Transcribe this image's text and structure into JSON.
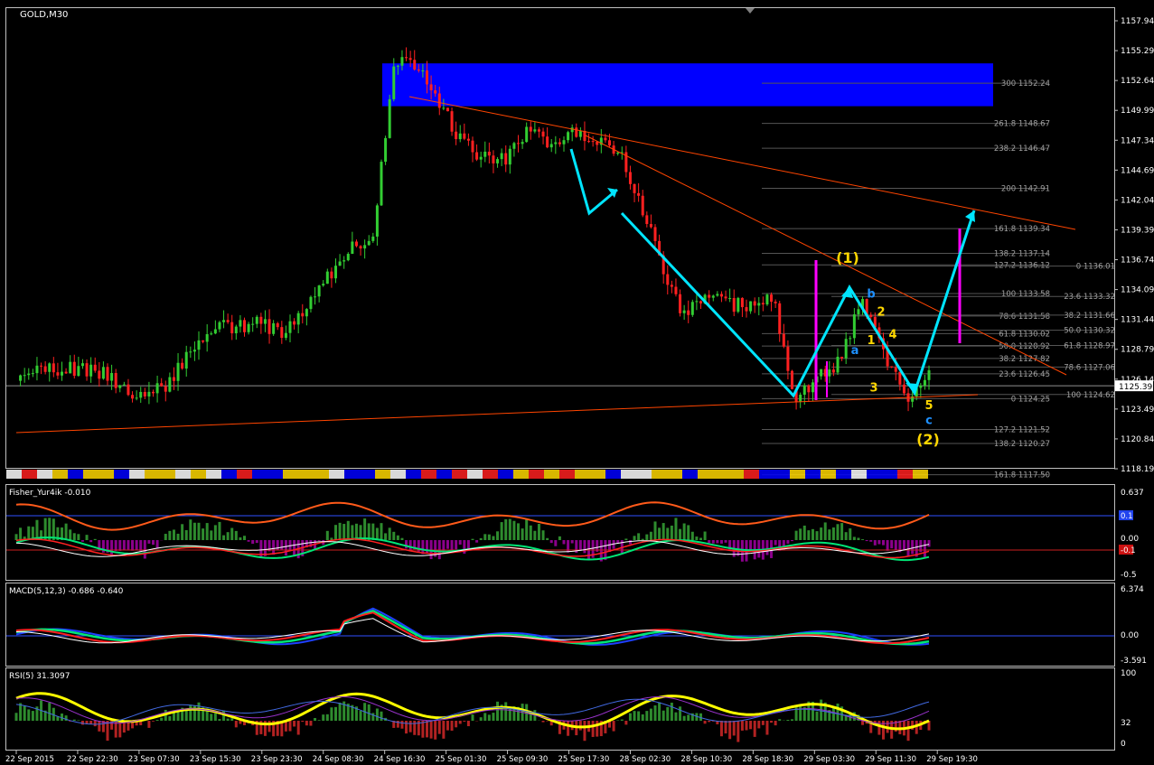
{
  "chart_data": [
    {
      "type": "candlestick",
      "title": "GOLD,M30",
      "y_ticks": [
        "1157.94",
        "1155.29",
        "1152.64",
        "1149.99",
        "1147.34",
        "1144.69",
        "1142.04",
        "1139.39",
        "1136.74",
        "1134.09",
        "1131.44",
        "1128.79",
        "1126.14",
        "1123.49",
        "1120.84",
        "1118.19"
      ],
      "ylim": [
        1118.19,
        1157.94
      ],
      "current_price": "1125.39",
      "anchor_prices": [
        1126.5,
        1127.2,
        1126.8,
        1127.0,
        1126.5,
        1125.0,
        1124.4,
        1126.0,
        1129.0,
        1131.0,
        1130.5,
        1131.0,
        1130.0,
        1132.0,
        1135.0,
        1137.5,
        1138.0,
        1154.5,
        1153.5,
        1150.5,
        1147.0,
        1145.5,
        1145.5,
        1148.0,
        1147.0,
        1148.0,
        1147.5,
        1146.5,
        1142.0,
        1136.0,
        1131.5,
        1134.0,
        1132.5,
        1132.5,
        1133.0,
        1124.5,
        1126.0,
        1127.5,
        1133.5,
        1128.0,
        1124.5,
        1126.5
      ],
      "fib_labels": [
        {
          "price": 1152.24,
          "text": "300 1152.24",
          "col": "left"
        },
        {
          "price": 1148.67,
          "text": "261.8 1148.67",
          "col": "left"
        },
        {
          "price": 1146.47,
          "text": "238.2 1146.47",
          "col": "left"
        },
        {
          "price": 1142.91,
          "text": "200 1142.91",
          "col": "left"
        },
        {
          "price": 1139.34,
          "text": "161.8 1139.34",
          "col": "left"
        },
        {
          "price": 1137.14,
          "text": "138.2 1137.14",
          "col": "left"
        },
        {
          "price": 1136.12,
          "text": "127.2 1136.12",
          "col": "left"
        },
        {
          "price": 1133.58,
          "text": "100 1133.58",
          "col": "left"
        },
        {
          "price": 1131.58,
          "text": "78.6 1131.58",
          "col": "left"
        },
        {
          "price": 1130.02,
          "text": "61.8 1130.02",
          "col": "left"
        },
        {
          "price": 1128.92,
          "text": "50.0 1128.92",
          "col": "left"
        },
        {
          "price": 1127.82,
          "text": "38.2 1127.82",
          "col": "left"
        },
        {
          "price": 1126.45,
          "text": "23.6 1126.45",
          "col": "left"
        },
        {
          "price": 1124.25,
          "text": "0 1124.25",
          "col": "left"
        },
        {
          "price": 1121.52,
          "text": "127.2 1121.52",
          "col": "left"
        },
        {
          "price": 1120.27,
          "text": "138.2 1120.27",
          "col": "left"
        },
        {
          "price": 1117.5,
          "text": "161.8 1117.50",
          "col": "left"
        },
        {
          "price": 1136.01,
          "text": "0 1136.01",
          "col": "right"
        },
        {
          "price": 1133.32,
          "text": "23.6 1133.32",
          "col": "right"
        },
        {
          "price": 1131.66,
          "text": "38.2 1131.66",
          "col": "right"
        },
        {
          "price": 1130.32,
          "text": "50.0 1130.32",
          "col": "right"
        },
        {
          "price": 1128.97,
          "text": "61.8 1128.97",
          "col": "right"
        },
        {
          "price": 1127.06,
          "text": "78.6 1127.06",
          "col": "right"
        },
        {
          "price": 1124.62,
          "text": "100 1124.62",
          "col": "right"
        }
      ],
      "wave_labels": [
        {
          "text": "(1)",
          "color": "#ffd700",
          "price": 1136.3
        },
        {
          "text": "b",
          "color": "#1e90ff",
          "price": 1133.2
        },
        {
          "text": "2",
          "color": "#ffd700",
          "price": 1131.6
        },
        {
          "text": "a",
          "color": "#1e90ff",
          "price": 1128.2
        },
        {
          "text": "1",
          "color": "#ffd700",
          "price": 1129.1
        },
        {
          "text": "4",
          "color": "#ffd700",
          "price": 1129.6
        },
        {
          "text": "3",
          "color": "#ffd700",
          "price": 1124.9
        },
        {
          "text": "5",
          "color": "#ffd700",
          "price": 1123.3
        },
        {
          "text": "c",
          "color": "#1e90ff",
          "price": 1122.0
        },
        {
          "text": "(2)",
          "color": "#ffd700",
          "price": 1120.2
        }
      ]
    },
    {
      "type": "indicator",
      "label": "Fisher_Yur4ik -0.010",
      "y_ticks": [
        "0.637",
        "0.00",
        "-0.5"
      ],
      "ylim": [
        -0.637,
        0.637
      ],
      "markers": [
        {
          "text": "0.1",
          "value": 0.1,
          "color": "#2244ee"
        },
        {
          "text": "-0.1",
          "value": -0.1,
          "color": "#cc1111"
        }
      ]
    },
    {
      "type": "indicator",
      "label": "MACD(5,12,3) -0.686 -0.640",
      "y_ticks": [
        "6.374",
        "0.00",
        "-3.591"
      ],
      "ylim": [
        -3.591,
        6.374
      ]
    },
    {
      "type": "indicator",
      "label": "RSI(5) 31.3097",
      "y_ticks": [
        "100",
        "32",
        "0"
      ],
      "ylim": [
        0,
        100
      ]
    }
  ],
  "x_ticks": [
    "22 Sep 2015",
    "22 Sep 22:30",
    "23 Sep 07:30",
    "23 Sep 15:30",
    "23 Sep 23:30",
    "24 Sep 08:30",
    "24 Sep 16:30",
    "25 Sep 01:30",
    "25 Sep 09:30",
    "25 Sep 17:30",
    "28 Sep 02:30",
    "28 Sep 10:30",
    "28 Sep 18:30",
    "29 Sep 03:30",
    "29 Sep 11:30",
    "29 Sep 19:30"
  ],
  "colors": {
    "bull": "#32cd32",
    "bear": "#ff2020",
    "zone": "#0000ff",
    "trend": "#ff4500",
    "wave": "#00e5ff",
    "magenta": "#ff00ff"
  }
}
